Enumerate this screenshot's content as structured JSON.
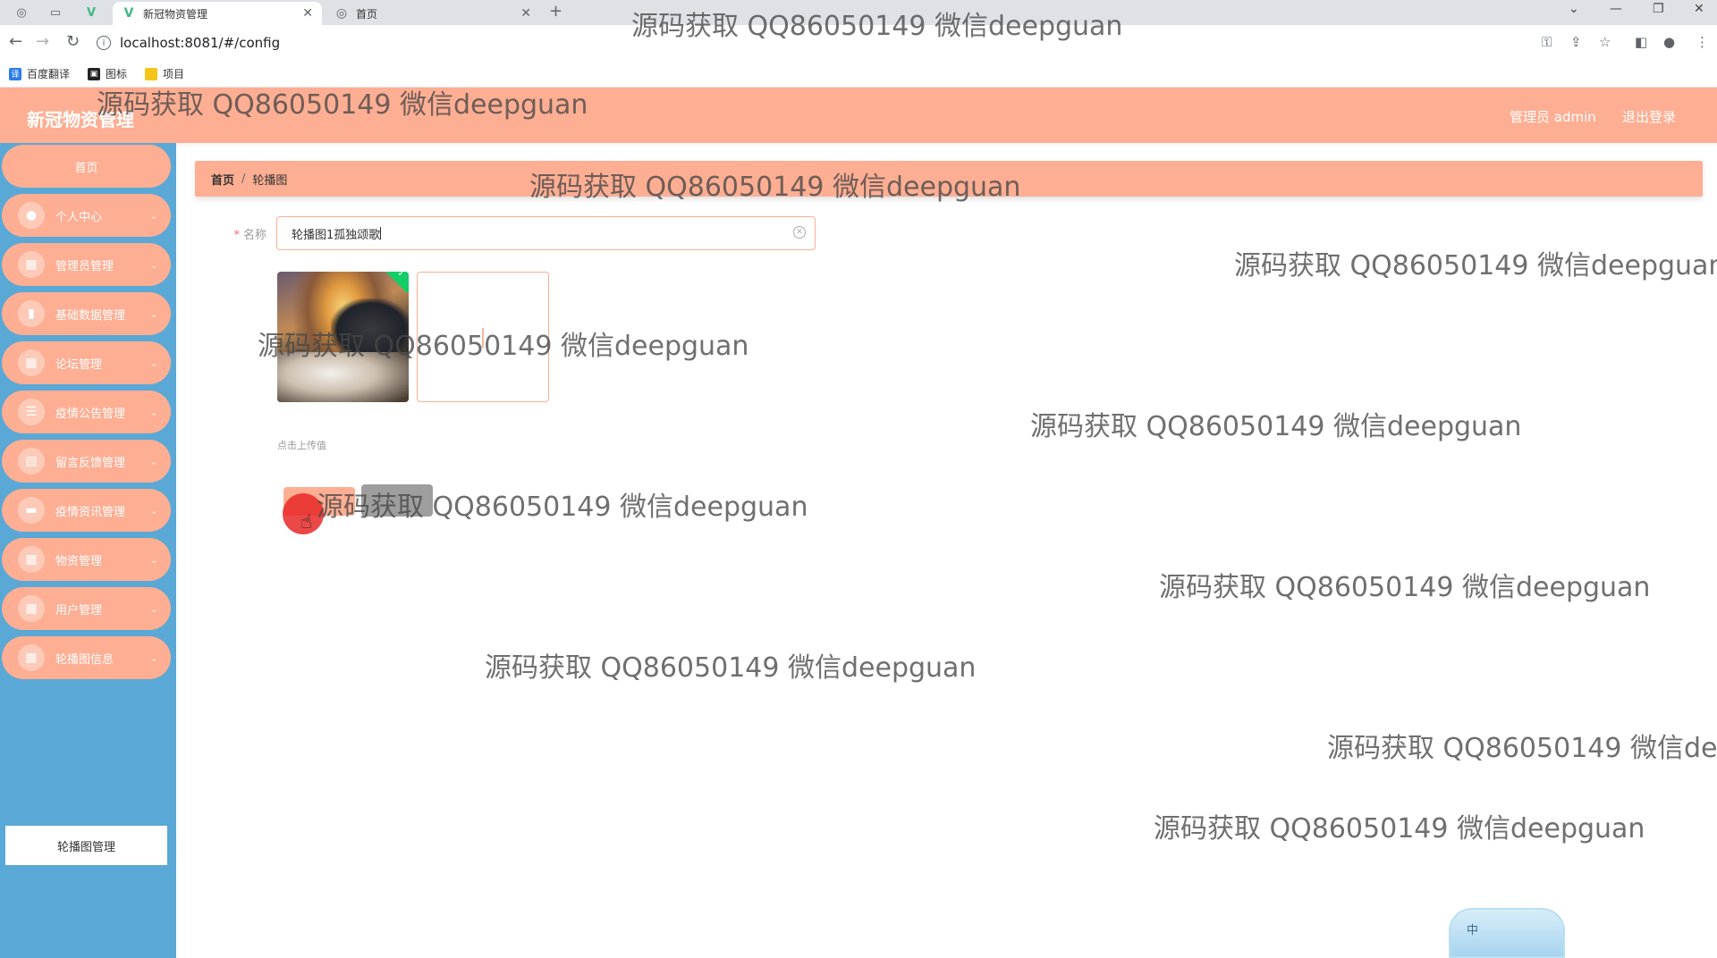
{
  "browser": {
    "tabs": [
      {
        "label": "新冠物资管理",
        "active": true,
        "icon": "vue-logo-icon"
      },
      {
        "label": "首页",
        "active": false,
        "icon": "globe-icon"
      }
    ],
    "url": "localhost:8081/#/config",
    "bookmarks": [
      {
        "label": "百度翻译",
        "icon": "translate-icon",
        "color": "#2b7de9"
      },
      {
        "label": "图标",
        "icon": "image-icon",
        "color": "#222222"
      },
      {
        "label": "项目",
        "icon": "folder-icon",
        "color": "#f5c518"
      }
    ]
  },
  "header": {
    "title": "新冠物资管理",
    "user": "管理员 admin",
    "logout": "退出登录"
  },
  "sidebar": {
    "items": [
      {
        "label": "首页",
        "icon": ""
      },
      {
        "label": "个人中心",
        "icon": "user-icon"
      },
      {
        "label": "管理员管理",
        "icon": "grid-icon"
      },
      {
        "label": "基础数据管理",
        "icon": "bar-chart-icon"
      },
      {
        "label": "论坛管理",
        "icon": "grid-icon"
      },
      {
        "label": "疫情公告管理",
        "icon": "list-icon"
      },
      {
        "label": "留言反馈管理",
        "icon": "clipboard-icon"
      },
      {
        "label": "疫情资讯管理",
        "icon": "document-icon"
      },
      {
        "label": "物资管理",
        "icon": "grid-icon"
      },
      {
        "label": "用户管理",
        "icon": "grid-icon"
      },
      {
        "label": "轮播图信息",
        "icon": "grid-icon"
      }
    ],
    "submenu_active": "轮播图管理"
  },
  "breadcrumb": {
    "home": "首页",
    "separator": "/",
    "current": "轮播图"
  },
  "form": {
    "name_label": "名称",
    "required_mark": "*",
    "name_value": "轮播图1孤独颂歌",
    "upload_tip": "点击上传值"
  },
  "watermark_text": "源码获取 QQ86050149 微信deepguan",
  "watermark_text_clipped": "源码获取 QQ86050149 微信dee",
  "watermark_text_partial": "源码获取",
  "watermark_text_partial2": "QQ86050149 微信deepguan",
  "ime": "中",
  "colors": {
    "accent": "#fdae93",
    "sidebar_bg": "#5aa8d6",
    "cancel": "#9e9e9e",
    "success": "#13ce66"
  }
}
